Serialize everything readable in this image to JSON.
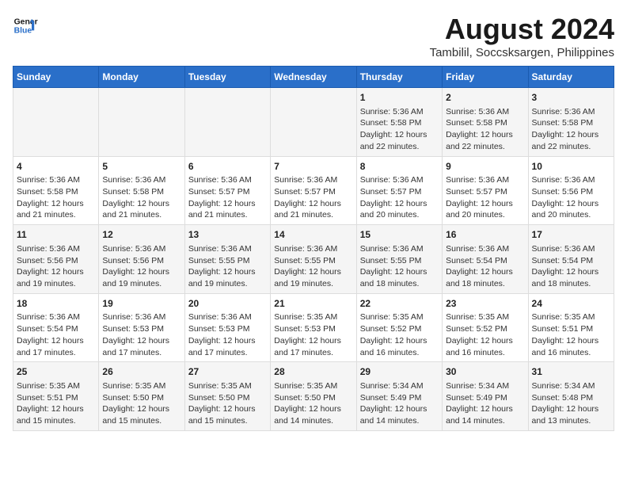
{
  "header": {
    "logo_line1": "General",
    "logo_line2": "Blue",
    "main_title": "August 2024",
    "subtitle": "Tambilil, Soccsksargen, Philippines"
  },
  "days_of_week": [
    "Sunday",
    "Monday",
    "Tuesday",
    "Wednesday",
    "Thursday",
    "Friday",
    "Saturday"
  ],
  "weeks": [
    [
      {
        "day": "",
        "info": ""
      },
      {
        "day": "",
        "info": ""
      },
      {
        "day": "",
        "info": ""
      },
      {
        "day": "",
        "info": ""
      },
      {
        "day": "1",
        "info": "Sunrise: 5:36 AM\nSunset: 5:58 PM\nDaylight: 12 hours\nand 22 minutes."
      },
      {
        "day": "2",
        "info": "Sunrise: 5:36 AM\nSunset: 5:58 PM\nDaylight: 12 hours\nand 22 minutes."
      },
      {
        "day": "3",
        "info": "Sunrise: 5:36 AM\nSunset: 5:58 PM\nDaylight: 12 hours\nand 22 minutes."
      }
    ],
    [
      {
        "day": "4",
        "info": "Sunrise: 5:36 AM\nSunset: 5:58 PM\nDaylight: 12 hours\nand 21 minutes."
      },
      {
        "day": "5",
        "info": "Sunrise: 5:36 AM\nSunset: 5:58 PM\nDaylight: 12 hours\nand 21 minutes."
      },
      {
        "day": "6",
        "info": "Sunrise: 5:36 AM\nSunset: 5:57 PM\nDaylight: 12 hours\nand 21 minutes."
      },
      {
        "day": "7",
        "info": "Sunrise: 5:36 AM\nSunset: 5:57 PM\nDaylight: 12 hours\nand 21 minutes."
      },
      {
        "day": "8",
        "info": "Sunrise: 5:36 AM\nSunset: 5:57 PM\nDaylight: 12 hours\nand 20 minutes."
      },
      {
        "day": "9",
        "info": "Sunrise: 5:36 AM\nSunset: 5:57 PM\nDaylight: 12 hours\nand 20 minutes."
      },
      {
        "day": "10",
        "info": "Sunrise: 5:36 AM\nSunset: 5:56 PM\nDaylight: 12 hours\nand 20 minutes."
      }
    ],
    [
      {
        "day": "11",
        "info": "Sunrise: 5:36 AM\nSunset: 5:56 PM\nDaylight: 12 hours\nand 19 minutes."
      },
      {
        "day": "12",
        "info": "Sunrise: 5:36 AM\nSunset: 5:56 PM\nDaylight: 12 hours\nand 19 minutes."
      },
      {
        "day": "13",
        "info": "Sunrise: 5:36 AM\nSunset: 5:55 PM\nDaylight: 12 hours\nand 19 minutes."
      },
      {
        "day": "14",
        "info": "Sunrise: 5:36 AM\nSunset: 5:55 PM\nDaylight: 12 hours\nand 19 minutes."
      },
      {
        "day": "15",
        "info": "Sunrise: 5:36 AM\nSunset: 5:55 PM\nDaylight: 12 hours\nand 18 minutes."
      },
      {
        "day": "16",
        "info": "Sunrise: 5:36 AM\nSunset: 5:54 PM\nDaylight: 12 hours\nand 18 minutes."
      },
      {
        "day": "17",
        "info": "Sunrise: 5:36 AM\nSunset: 5:54 PM\nDaylight: 12 hours\nand 18 minutes."
      }
    ],
    [
      {
        "day": "18",
        "info": "Sunrise: 5:36 AM\nSunset: 5:54 PM\nDaylight: 12 hours\nand 17 minutes."
      },
      {
        "day": "19",
        "info": "Sunrise: 5:36 AM\nSunset: 5:53 PM\nDaylight: 12 hours\nand 17 minutes."
      },
      {
        "day": "20",
        "info": "Sunrise: 5:36 AM\nSunset: 5:53 PM\nDaylight: 12 hours\nand 17 minutes."
      },
      {
        "day": "21",
        "info": "Sunrise: 5:35 AM\nSunset: 5:53 PM\nDaylight: 12 hours\nand 17 minutes."
      },
      {
        "day": "22",
        "info": "Sunrise: 5:35 AM\nSunset: 5:52 PM\nDaylight: 12 hours\nand 16 minutes."
      },
      {
        "day": "23",
        "info": "Sunrise: 5:35 AM\nSunset: 5:52 PM\nDaylight: 12 hours\nand 16 minutes."
      },
      {
        "day": "24",
        "info": "Sunrise: 5:35 AM\nSunset: 5:51 PM\nDaylight: 12 hours\nand 16 minutes."
      }
    ],
    [
      {
        "day": "25",
        "info": "Sunrise: 5:35 AM\nSunset: 5:51 PM\nDaylight: 12 hours\nand 15 minutes."
      },
      {
        "day": "26",
        "info": "Sunrise: 5:35 AM\nSunset: 5:50 PM\nDaylight: 12 hours\nand 15 minutes."
      },
      {
        "day": "27",
        "info": "Sunrise: 5:35 AM\nSunset: 5:50 PM\nDaylight: 12 hours\nand 15 minutes."
      },
      {
        "day": "28",
        "info": "Sunrise: 5:35 AM\nSunset: 5:50 PM\nDaylight: 12 hours\nand 14 minutes."
      },
      {
        "day": "29",
        "info": "Sunrise: 5:34 AM\nSunset: 5:49 PM\nDaylight: 12 hours\nand 14 minutes."
      },
      {
        "day": "30",
        "info": "Sunrise: 5:34 AM\nSunset: 5:49 PM\nDaylight: 12 hours\nand 14 minutes."
      },
      {
        "day": "31",
        "info": "Sunrise: 5:34 AM\nSunset: 5:48 PM\nDaylight: 12 hours\nand 13 minutes."
      }
    ]
  ]
}
